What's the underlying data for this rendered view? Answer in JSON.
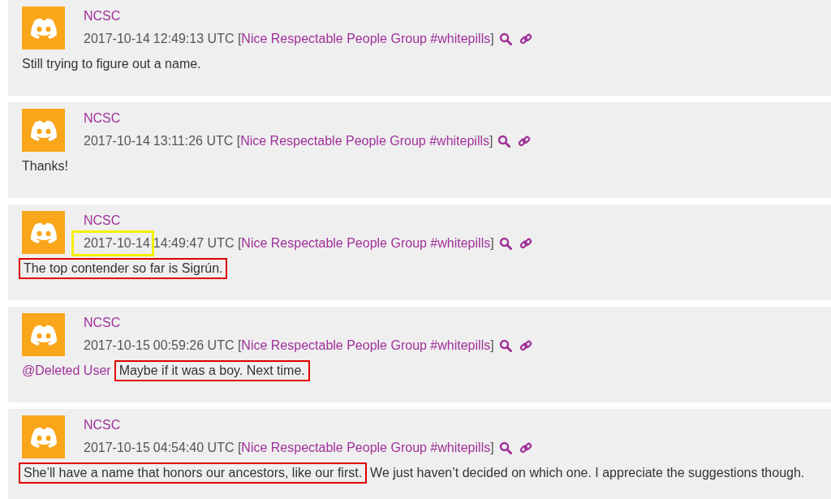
{
  "messages": [
    {
      "author": "NCSC",
      "meta": [
        {
          "kind": "date",
          "text": "2017-10-14",
          "boxed": false
        },
        {
          "kind": "plain",
          "text": "12:49:13 UTC ["
        },
        {
          "kind": "link",
          "text": "Nice Respectable People Group #whitepills"
        },
        {
          "kind": "plain",
          "text": "]"
        }
      ],
      "body": [
        {
          "kind": "plain",
          "text": "Still trying to figure out a name.",
          "boxed": false
        }
      ]
    },
    {
      "author": "NCSC",
      "meta": [
        {
          "kind": "date",
          "text": "2017-10-14",
          "boxed": false
        },
        {
          "kind": "plain",
          "text": "13:11:26 UTC ["
        },
        {
          "kind": "link",
          "text": "Nice Respectable People Group #whitepills"
        },
        {
          "kind": "plain",
          "text": "]"
        }
      ],
      "body": [
        {
          "kind": "plain",
          "text": "Thanks!",
          "boxed": false
        }
      ]
    },
    {
      "author": "NCSC",
      "meta": [
        {
          "kind": "date",
          "text": "2017-10-14",
          "boxed": true
        },
        {
          "kind": "plain",
          "text": "14:49:47 UTC ["
        },
        {
          "kind": "link",
          "text": "Nice Respectable People Group #whitepills"
        },
        {
          "kind": "plain",
          "text": "]"
        }
      ],
      "body": [
        {
          "kind": "plain",
          "text": "The top contender so far is Sigrún.",
          "boxed": true
        }
      ]
    },
    {
      "author": "NCSC",
      "meta": [
        {
          "kind": "date",
          "text": "2017-10-15",
          "boxed": false
        },
        {
          "kind": "plain",
          "text": "00:59:26 UTC ["
        },
        {
          "kind": "link",
          "text": "Nice Respectable People Group #whitepills"
        },
        {
          "kind": "plain",
          "text": "]"
        }
      ],
      "body": [
        {
          "kind": "mention",
          "text": "@Deleted User",
          "boxed": false
        },
        {
          "kind": "plain",
          "text": "Maybe if it was a boy. Next time.",
          "boxed": true
        }
      ]
    },
    {
      "author": "NCSC",
      "meta": [
        {
          "kind": "date",
          "text": "2017-10-15",
          "boxed": false
        },
        {
          "kind": "plain",
          "text": "04:54:40 UTC ["
        },
        {
          "kind": "link",
          "text": "Nice Respectable People Group #whitepills"
        },
        {
          "kind": "plain",
          "text": "]"
        }
      ],
      "body": [
        {
          "kind": "plain",
          "text": "She’ll have a name that honors our ancestors, like our first.",
          "boxed": true
        },
        {
          "kind": "plain",
          "text": "We just haven’t decided on which one. I appreciate the suggestions though.",
          "boxed": false
        }
      ]
    }
  ]
}
